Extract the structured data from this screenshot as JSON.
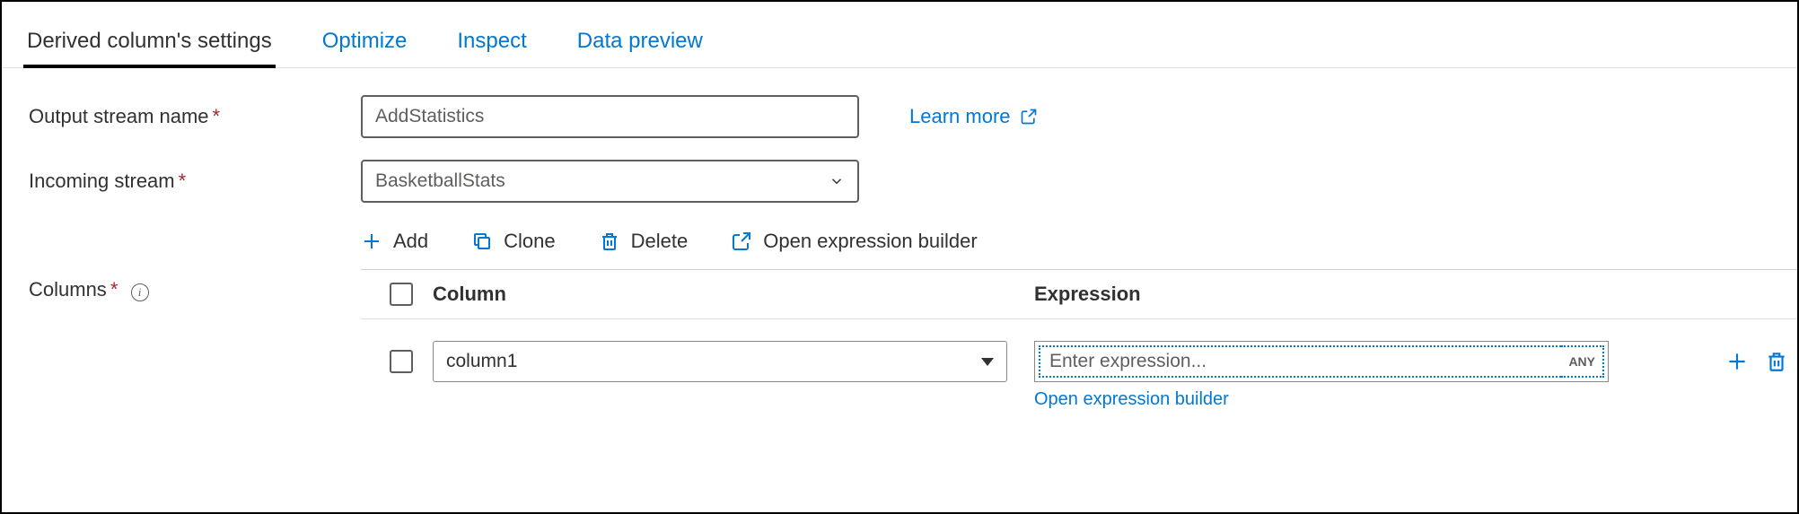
{
  "tabs": {
    "settings": "Derived column's settings",
    "optimize": "Optimize",
    "inspect": "Inspect",
    "preview": "Data preview"
  },
  "labels": {
    "output_stream": "Output stream name",
    "incoming_stream": "Incoming stream",
    "columns": "Columns"
  },
  "fields": {
    "output_stream_value": "AddStatistics",
    "incoming_stream_value": "BasketballStats"
  },
  "links": {
    "learn_more": "Learn more",
    "open_expression_builder": "Open expression builder"
  },
  "toolbar": {
    "add": "Add",
    "clone": "Clone",
    "delete": "Delete",
    "open_builder": "Open expression builder"
  },
  "grid": {
    "header_column": "Column",
    "header_expression": "Expression",
    "rows": [
      {
        "name": "column1",
        "expr_placeholder": "Enter expression...",
        "type_badge": "ANY"
      }
    ]
  }
}
